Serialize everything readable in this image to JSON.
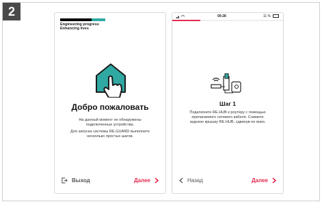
{
  "step_number": "2",
  "screen1": {
    "brand_line1": "Engineering progress",
    "brand_line2": "Enhancing lives",
    "title": "Добро пожаловать",
    "line1": "На данный момент не обнаружены",
    "line2": "подключенные устройства.",
    "line3": "Для запуска системы RE.GUARD выполните",
    "line4": "несколько простых шагов.",
    "exit_label": "Выход",
    "next_label": "Далее",
    "accent": "#e4294e",
    "icon_color": "#2fa9a2"
  },
  "screen2": {
    "status_time": "09:28",
    "status_battery": "11 %",
    "progress": 0.25,
    "title": "Шаг 1",
    "line1": "Подключите RE.HUB к роутеру с помощью",
    "line2": "прилагаемого сетевого кабеля. Снимите",
    "line3": "заднюю крышку RE.HUB, сдвинув ее вниз.",
    "back_label": "Назад",
    "next_label": "Далее"
  }
}
